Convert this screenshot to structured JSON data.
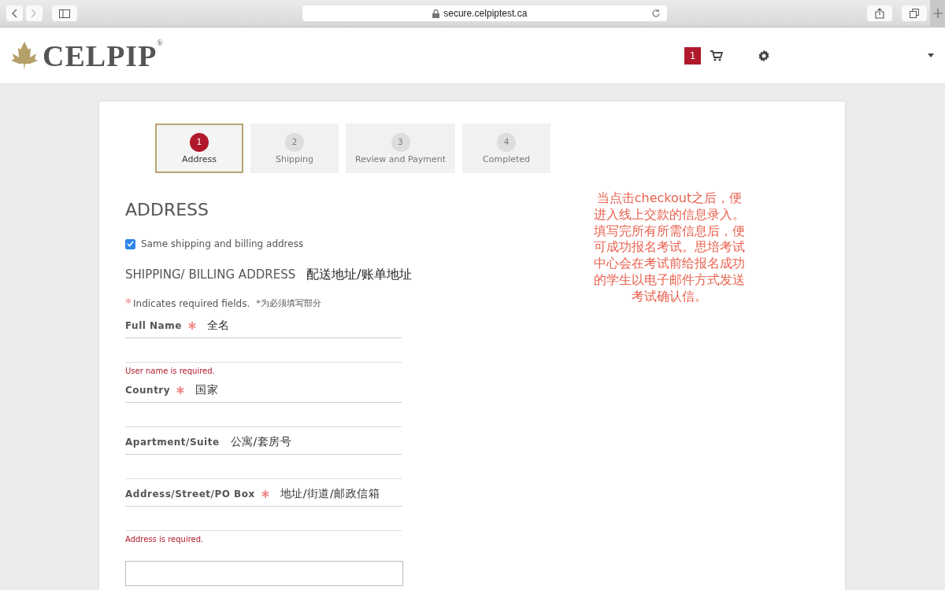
{
  "browser": {
    "url": "secure.celpiptest.ca"
  },
  "header": {
    "logo": "CELPIP",
    "logo_mark": "®",
    "cart_count": "1"
  },
  "steps": [
    {
      "number": "1",
      "label": "Address",
      "selected": true
    },
    {
      "number": "2",
      "label": "Shipping",
      "selected": false
    },
    {
      "number": "3",
      "label": "Review and Payment",
      "selected": false
    },
    {
      "number": "4",
      "label": "Completed",
      "selected": false
    }
  ],
  "title": "ADDRESS",
  "same_address": {
    "label": "Same shipping and billing address",
    "checked": true
  },
  "section": {
    "title": "SHIPPING/ BILLING ADDRESS",
    "note": "配送地址/账单地址"
  },
  "required_note": {
    "mark": "*",
    "text": "Indicates required fields.",
    "note": "*为必须填写部分"
  },
  "fields": [
    {
      "label": "Full Name",
      "required": true,
      "note": "全名",
      "error": "User name is required."
    },
    {
      "label": "Country",
      "required": true,
      "note": "国家"
    },
    {
      "label": "Apartment/Suite",
      "required": false,
      "note": "公寓/套房号"
    },
    {
      "label": "Address/Street/PO Box",
      "required": true,
      "note": "地址/街道/邮政信箱",
      "error": "Address is required."
    }
  ],
  "annotation": "当点击checkout之后，便进入线上交款的信息录入。填写完所有所需信息后，便可成功报名考试。思培考试中心会在考试前给报名成功的学生以电子邮件方式发送考试确认信。"
}
